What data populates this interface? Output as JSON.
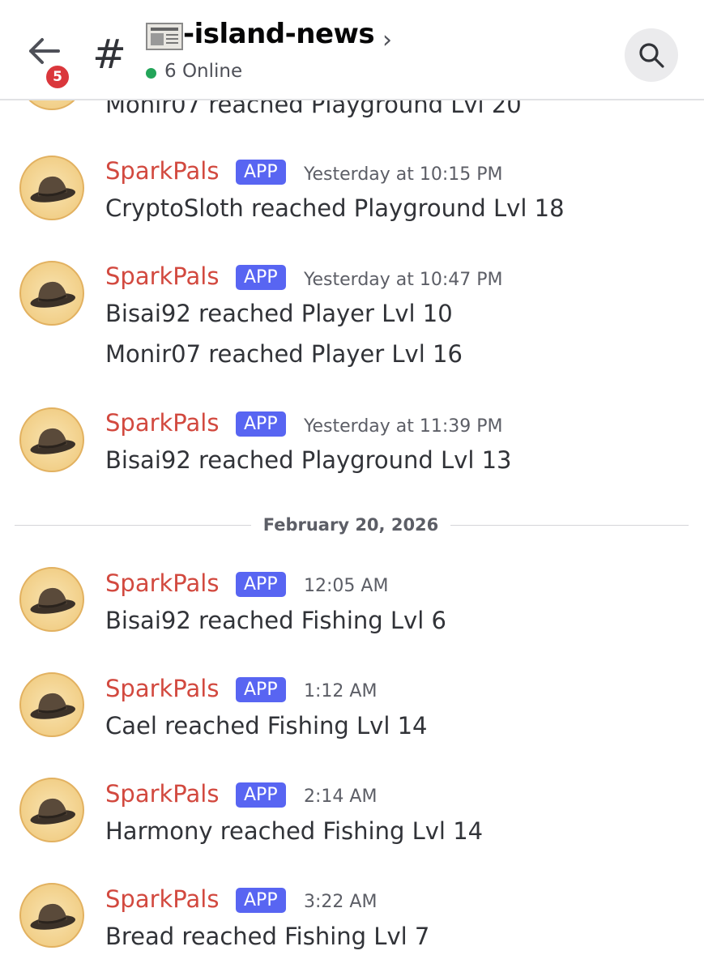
{
  "header": {
    "unread_badge": "5",
    "hash": "#",
    "channel_name": "-island-news",
    "chevron": "›",
    "online_text": "6 Online",
    "online_color": "#23a559",
    "icons": {
      "back": "arrow-left-icon",
      "search": "search-icon",
      "channel": "newspaper-emoji-icon"
    }
  },
  "messages": [
    {
      "partial": true,
      "lines": [
        "Monir07 reached Playground Lvl 20"
      ]
    },
    {
      "author": "SparkPals",
      "tag": "APP",
      "time": "Yesterday at 10:15 PM",
      "lines": [
        "CryptoSloth reached Playground Lvl 18"
      ]
    },
    {
      "author": "SparkPals",
      "tag": "APP",
      "time": "Yesterday at 10:47 PM",
      "lines": [
        "Bisai92 reached Player Lvl 10",
        "Monir07 reached Player Lvl 16"
      ]
    },
    {
      "author": "SparkPals",
      "tag": "APP",
      "time": "Yesterday at 11:39 PM",
      "lines": [
        "Bisai92 reached Playground Lvl 13"
      ]
    },
    {
      "author": "SparkPals",
      "tag": "APP",
      "time": "12:05 AM",
      "lines": [
        "Bisai92 reached Fishing Lvl 6"
      ]
    },
    {
      "author": "SparkPals",
      "tag": "APP",
      "time": "1:12 AM",
      "lines": [
        "Cael reached Fishing Lvl 14"
      ]
    },
    {
      "author": "SparkPals",
      "tag": "APP",
      "time": "2:14 AM",
      "lines": [
        "Harmony reached Fishing Lvl 14"
      ]
    },
    {
      "author": "SparkPals",
      "tag": "APP",
      "time": "3:22 AM",
      "lines": [
        "Bread reached Fishing Lvl 7"
      ]
    }
  ],
  "date_divider": "February 20, 2026",
  "colors": {
    "author": "#d2493f",
    "app_tag": "#5865f2",
    "badge": "#da373c"
  }
}
